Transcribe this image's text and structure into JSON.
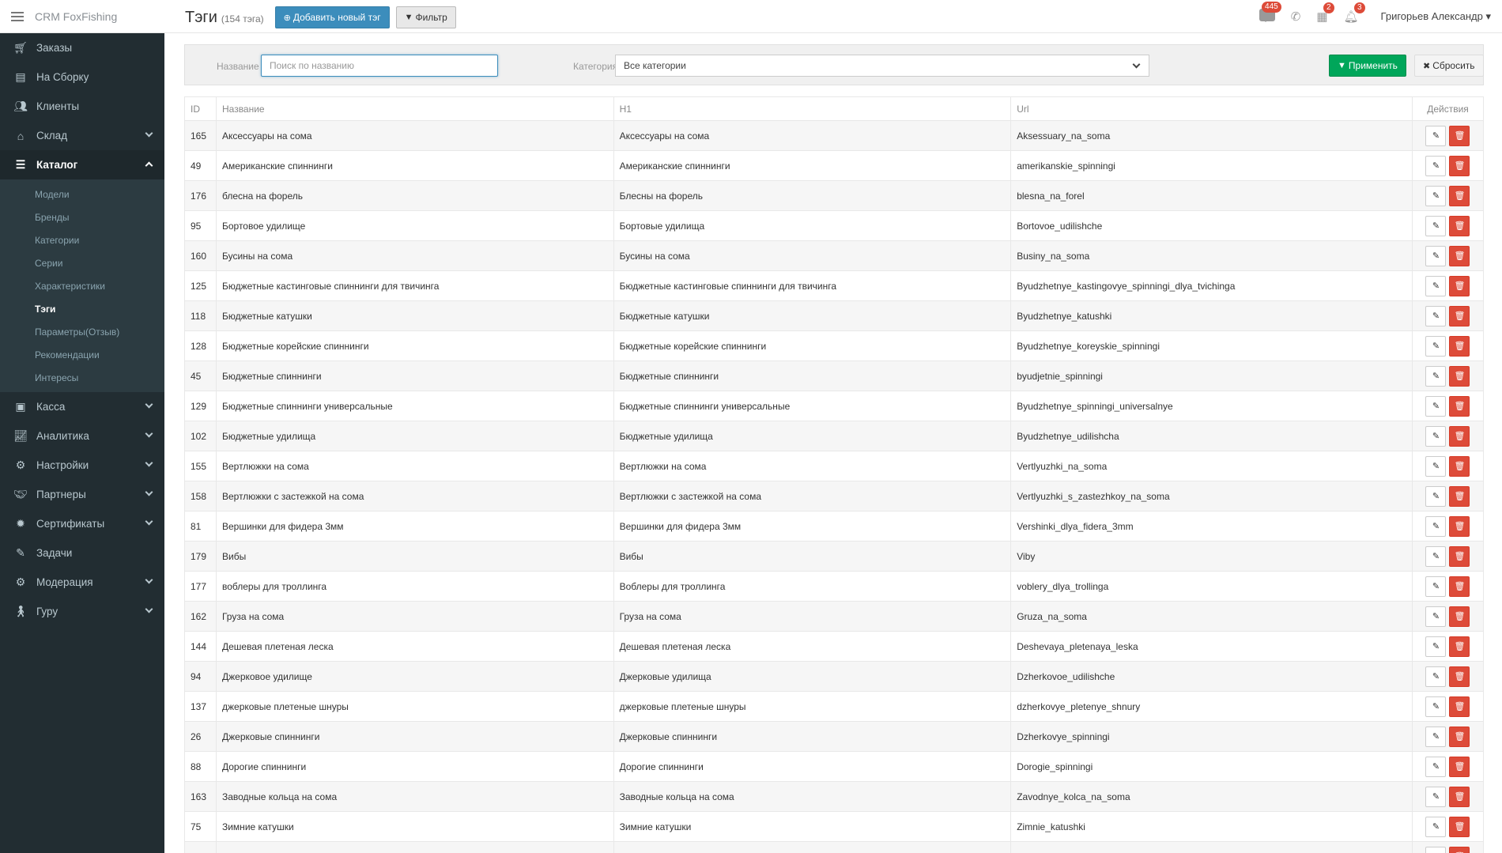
{
  "brand": {
    "name": "CRM FoxFishing"
  },
  "header": {
    "title": "Тэги",
    "count": "(154 тэга)",
    "add_label": "Добавить новый тэг",
    "filter_label": "Фильтр",
    "chat_badge": "445",
    "gift_badge": "2",
    "bell_badge": "3",
    "user": "Григорьев Александр"
  },
  "sidebar": {
    "items": [
      {
        "label": "Заказы",
        "icon": "cart-icon"
      },
      {
        "label": "На Сборку",
        "icon": "archive-icon"
      },
      {
        "label": "Клиенты",
        "icon": "users-icon"
      },
      {
        "label": "Склад",
        "icon": "home-icon"
      },
      {
        "label": "Каталог",
        "icon": "list-icon"
      },
      {
        "label": "Касса",
        "icon": "money-icon"
      },
      {
        "label": "Аналитика",
        "icon": "chart-icon"
      },
      {
        "label": "Настройки",
        "icon": "gears-icon"
      },
      {
        "label": "Партнеры",
        "icon": "handshake-icon"
      },
      {
        "label": "Сертификаты",
        "icon": "certificate-icon"
      },
      {
        "label": "Задачи",
        "icon": "pencil-icon"
      },
      {
        "label": "Модерация",
        "icon": "gears-icon"
      },
      {
        "label": "Гуру",
        "icon": "person-walking-icon"
      }
    ],
    "catalog_sub": [
      "Модели",
      "Бренды",
      "Категории",
      "Серии",
      "Характеристики",
      "Тэги",
      "Параметры(Отзыв)",
      "Рекомендации",
      "Интересы"
    ]
  },
  "filter": {
    "name_label": "Название",
    "name_placeholder": "Поиск по названию",
    "category_label": "Категория",
    "category_value": "Все категории",
    "apply_label": "Применить",
    "reset_label": "Сбросить"
  },
  "table": {
    "headers": {
      "id": "ID",
      "name": "Название",
      "h1": "H1",
      "url": "Url",
      "actions": "Действия"
    },
    "rows": [
      {
        "id": "165",
        "name": "Аксессуары на сома",
        "h1": "Аксессуары на сома",
        "url": "Aksessuary_na_soma"
      },
      {
        "id": "49",
        "name": "Американские спиннинги",
        "h1": "Американские спиннинги",
        "url": "amerikanskie_spinningi"
      },
      {
        "id": "176",
        "name": "блесна на форель",
        "h1": "Блесны на форель",
        "url": "blesna_na_forel"
      },
      {
        "id": "95",
        "name": "Бортовое удилище",
        "h1": "Бортовые удилища",
        "url": "Bortovoe_udilishche"
      },
      {
        "id": "160",
        "name": "Бусины на сома",
        "h1": "Бусины на сома",
        "url": "Businy_na_soma"
      },
      {
        "id": "125",
        "name": "Бюджетные кастинговые спиннинги для твичинга",
        "h1": "Бюджетные кастинговые спиннинги для твичинга",
        "url": "Byudzhetnye_kastingovye_spinningi_dlya_tvichinga"
      },
      {
        "id": "118",
        "name": "Бюджетные катушки",
        "h1": "Бюджетные катушки",
        "url": "Byudzhetnye_katushki"
      },
      {
        "id": "128",
        "name": "Бюджетные корейские спиннинги",
        "h1": "Бюджетные корейские спиннинги",
        "url": "Byudzhetnye_koreyskie_spinningi"
      },
      {
        "id": "45",
        "name": "Бюджетные спиннинги",
        "h1": "Бюджетные спиннинги",
        "url": "byudjetnie_spinningi"
      },
      {
        "id": "129",
        "name": "Бюджетные спиннинги универсальные",
        "h1": "Бюджетные спиннинги универсальные",
        "url": "Byudzhetnye_spinningi_universalnye"
      },
      {
        "id": "102",
        "name": "Бюджетные удилища",
        "h1": "Бюджетные удилища",
        "url": "Byudzhetnye_udilishcha"
      },
      {
        "id": "155",
        "name": "Вертлюжки на сома",
        "h1": "Вертлюжки на сома",
        "url": "Vertlyuzhki_na_soma"
      },
      {
        "id": "158",
        "name": "Вертлюжки с застежкой на сома",
        "h1": "Вертлюжки с застежкой на сома",
        "url": "Vertlyuzhki_s_zastezhkoy_na_soma"
      },
      {
        "id": "81",
        "name": "Вершинки для фидера 3мм",
        "h1": "Вершинки для фидера 3мм",
        "url": "Vershinki_dlya_fidera_3mm"
      },
      {
        "id": "179",
        "name": "Вибы",
        "h1": "Вибы",
        "url": "Viby"
      },
      {
        "id": "177",
        "name": "воблеры для троллинга",
        "h1": "Воблеры для троллинга",
        "url": "voblery_dlya_trollinga"
      },
      {
        "id": "162",
        "name": "Груза на сома",
        "h1": "Груза на сома",
        "url": "Gruza_na_soma"
      },
      {
        "id": "144",
        "name": "Дешевая плетеная леска",
        "h1": "Дешевая плетеная леска",
        "url": "Deshevaya_pletenaya_leska"
      },
      {
        "id": "94",
        "name": "Джерковое удилище",
        "h1": "Джерковые удилища",
        "url": "Dzherkovoe_udilishche"
      },
      {
        "id": "137",
        "name": "джерковые плетеные шнуры",
        "h1": "джерковые плетеные шнуры",
        "url": "dzherkovye_pletenye_shnury"
      },
      {
        "id": "26",
        "name": "Джерковые спиннинги",
        "h1": "Джерковые спиннинги",
        "url": "Dzherkovye_spinningi"
      },
      {
        "id": "88",
        "name": "Дорогие спиннинги",
        "h1": "Дорогие спиннинги",
        "url": "Dorogie_spinningi"
      },
      {
        "id": "163",
        "name": "Заводные кольца на сома",
        "h1": "Заводные кольца на сома",
        "url": "Zavodnye_kolca_na_soma"
      },
      {
        "id": "75",
        "name": "Зимние катушки",
        "h1": "Зимние катушки",
        "url": "Zimnie_katushki"
      },
      {
        "id": "",
        "name": "",
        "h1": "",
        "url": ""
      }
    ]
  },
  "colors": {
    "sidebar": "#222d32",
    "primary": "#3c8dbc",
    "success": "#00a65a",
    "danger": "#dd4b39"
  }
}
